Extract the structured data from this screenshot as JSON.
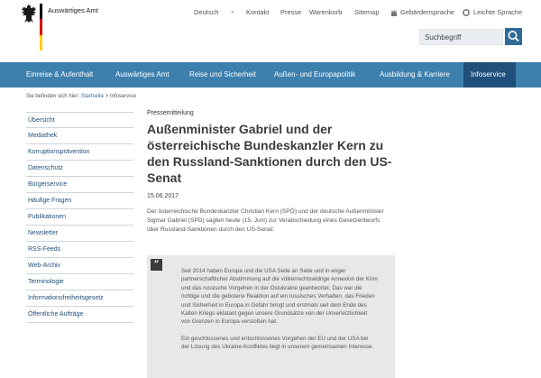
{
  "header": {
    "org_name": "Auswärtiges Amt",
    "flag_colors": [
      "#000000",
      "#dd0000",
      "#ffce00"
    ]
  },
  "topnav": {
    "language": "Deutsch",
    "links": [
      "Kontakt",
      "Presse",
      "Warenkorb",
      "Sitemap"
    ],
    "sign_language": "Gebärdensprache",
    "easy_language": "Leichte Sprache"
  },
  "search": {
    "placeholder": "Suchbegriff"
  },
  "mainnav": {
    "items": [
      "Einreise & Aufenthalt",
      "Auswärtiges Amt",
      "Reise und Sicherheit",
      "Außen- und Europapolitik",
      "Ausbildung & Karriere",
      "Infoservice"
    ],
    "active_index": 5,
    "colors": {
      "bar": "#3d7fad",
      "active": "#1f4f7a"
    }
  },
  "breadcrumb": {
    "prefix": "Sie befinden sich hier:",
    "home": "Startseite",
    "separator": ">",
    "current": "Infoservice"
  },
  "sidebar": {
    "items": [
      "Übersicht",
      "Mediathek",
      "Korruptionsprävention",
      "Datenschutz",
      "Bürgerservice",
      "Häufige Fragen",
      "Publikationen",
      "Newsletter",
      "RSS-Feeds",
      "Web-Archiv",
      "Terminologie",
      "Informationsfreiheitsgesetz",
      "Öffentliche Aufträge"
    ]
  },
  "article": {
    "kicker": "Pressemitteilung",
    "title": "Außenminister Gabriel und der österreichische Bundeskanzler Kern zu den Russland-Sanktionen durch den US-Senat",
    "date": "15.06.2017",
    "intro": "Der österreichische Bundeskanzler Christian Kern (SPÖ) und der deutsche Außenminister Sigmar Gabriel (SPD) sagten heute (15. Juni) zur Verabschiedung eines Gesetzentwurfs über Russland-Sanktionen durch den US-Senat:",
    "quote_mark": "”",
    "quote_paragraphs": [
      "Seit 2014 haben Europa und die USA Seite an Seite und in enger partnerschaftlicher Abstimmung auf die völkerrechtswidrige Annexion der Krim und das russische Vorgehen in der Ostukraine geantwortet. Das war die richtige und die gebotene Reaktion auf ein russisches Verhalten, das Frieden und Sicherheit in Europa in Gefahr bringt und erstmals seit dem Ende des Kalten Kriegs eklatant gegen unsere Grundsätze von der Unverletzlichkeit von Grenzen in Europa verstoßen hat.",
      "Ein geschlossenes und entschlossenes Vorgehen der EU und der USA bei der Lösung des Ukraine-Konfliktes liegt in unserem gemeinsamen Interesse."
    ]
  }
}
